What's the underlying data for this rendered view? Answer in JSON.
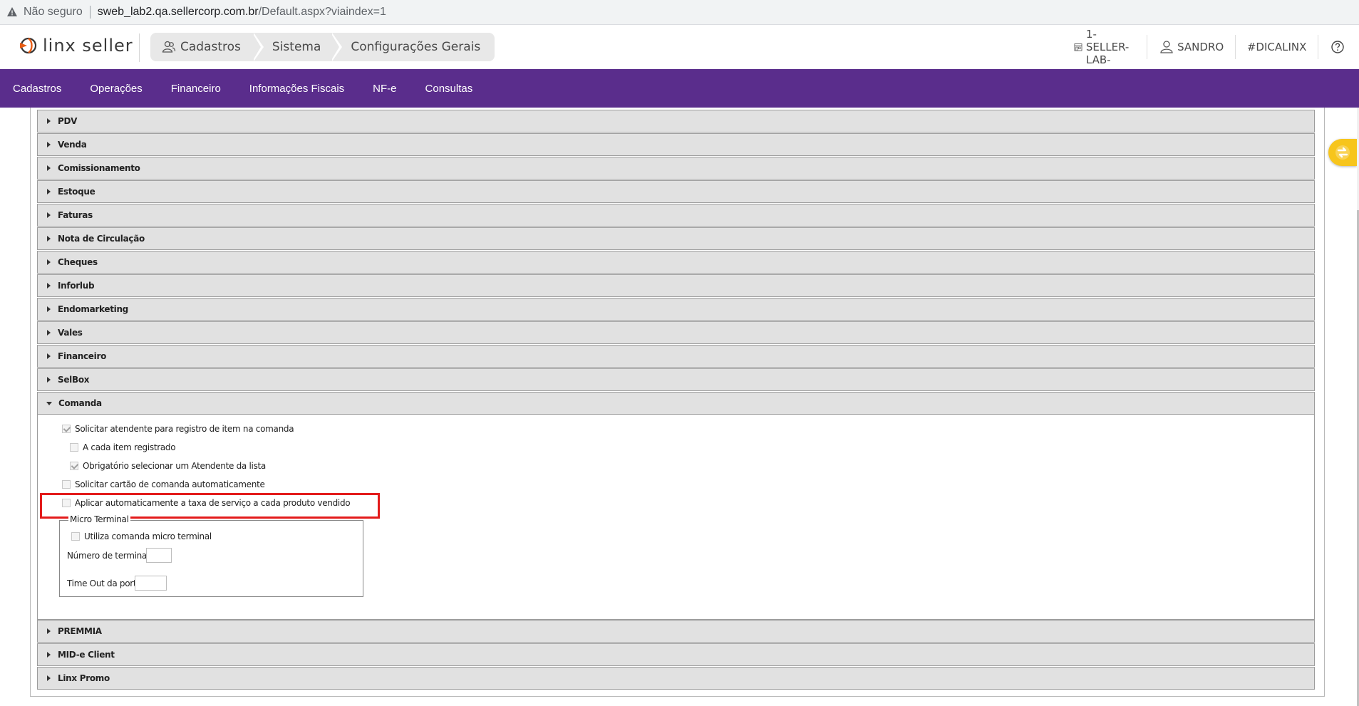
{
  "browser": {
    "security_label": "Não seguro",
    "host": "sweb_lab2.qa.sellercorp.com.br",
    "path": "/Default.aspx?viaindex=1"
  },
  "header": {
    "logo_text": "linx seller",
    "breadcrumbs": [
      "Cadastros",
      "Sistema",
      "Configurações Gerais"
    ],
    "store": "1-SELLER-LAB-",
    "user": "SANDRO",
    "tip": "#DICALINX"
  },
  "menu": [
    "Cadastros",
    "Operações",
    "Financeiro",
    "Informações Fiscais",
    "NF-e",
    "Consultas"
  ],
  "sections_top": [
    "PDV",
    "Venda",
    "Comissionamento",
    "Estoque",
    "Faturas",
    "Nota de Circulação",
    "Cheques",
    "Inforlub",
    "Endomarketing",
    "Vales",
    "Financeiro",
    "SelBox"
  ],
  "comanda": {
    "title": "Comanda",
    "options": [
      {
        "label": "Solicitar atendente para registro de item na comanda",
        "checked": true
      },
      {
        "label": "A cada item registrado",
        "checked": false
      },
      {
        "label": "Obrigatório selecionar um Atendente da lista",
        "checked": true
      },
      {
        "label": "Solicitar cartão de comanda automaticamente",
        "checked": false
      },
      {
        "label": "Aplicar automaticamente a taxa de serviço a cada produto vendido",
        "checked": false
      }
    ],
    "micro_terminal": {
      "legend": "Micro Terminal",
      "use_label": "Utiliza comanda micro terminal",
      "terminals_label": "Número de terminais",
      "terminals_value": "",
      "timeout_label": "Time Out da porta",
      "timeout_value": ""
    }
  },
  "sections_bottom": [
    "PREMMIA",
    "MID-e Client",
    "Linx Promo"
  ],
  "colors": {
    "menu_bg": "#5a2d8c",
    "highlight": "#e31b1b",
    "sync_button": "#f7c51c"
  }
}
